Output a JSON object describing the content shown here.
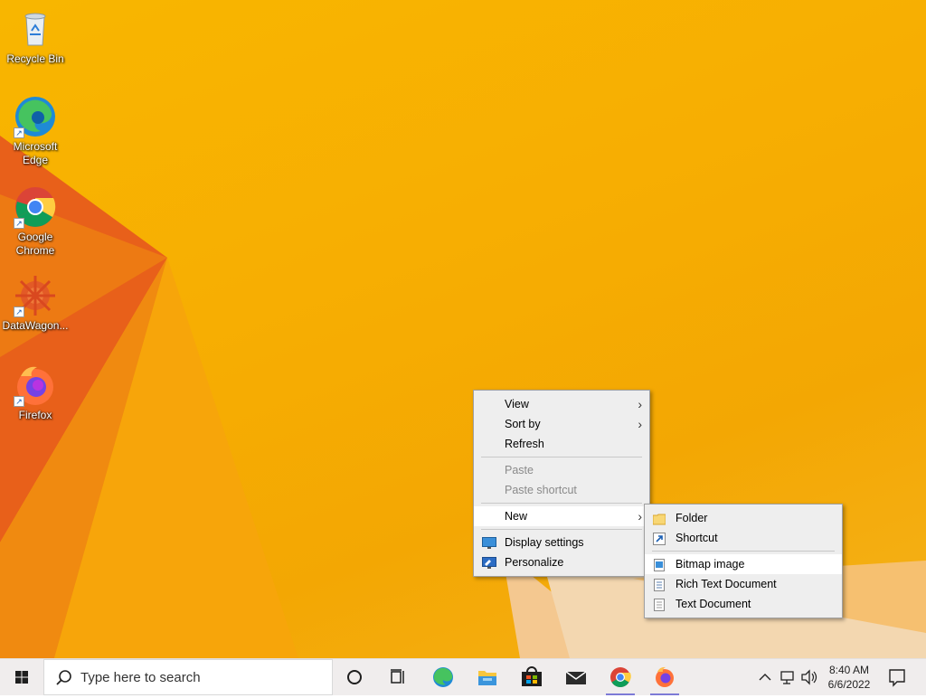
{
  "desktop": {
    "icons": [
      {
        "label": "Recycle Bin",
        "icon": "recycle-bin-icon"
      },
      {
        "label": "Microsoft Edge",
        "icon": "edge-icon"
      },
      {
        "label": "Google Chrome",
        "icon": "chrome-icon"
      },
      {
        "label": "DataWagon...",
        "icon": "datawagon-icon"
      },
      {
        "label": "Firefox",
        "icon": "firefox-icon"
      }
    ]
  },
  "context_menu": {
    "items": [
      {
        "label": "View",
        "has_submenu": true
      },
      {
        "label": "Sort by",
        "has_submenu": true
      },
      {
        "label": "Refresh"
      },
      {
        "label": "Paste",
        "disabled": true
      },
      {
        "label": "Paste shortcut",
        "disabled": true
      },
      {
        "label": "New",
        "has_submenu": true,
        "highlighted": true
      },
      {
        "label": "Display settings",
        "icon": "display-icon"
      },
      {
        "label": "Personalize",
        "icon": "personalize-icon"
      }
    ]
  },
  "new_submenu": {
    "items": [
      {
        "label": "Folder",
        "icon": "folder-icon"
      },
      {
        "label": "Shortcut",
        "icon": "shortcut-icon"
      },
      {
        "label": "Bitmap image",
        "icon": "bitmap-icon",
        "highlighted": true
      },
      {
        "label": "Rich Text Document",
        "icon": "rich-text-icon"
      },
      {
        "label": "Text Document",
        "icon": "text-document-icon"
      }
    ]
  },
  "taskbar": {
    "search_placeholder": "Type here to search",
    "pinned": [
      "cortana-icon",
      "task-view-icon",
      "edge-icon",
      "file-explorer-icon",
      "store-icon",
      "mail-icon",
      "chrome-icon",
      "firefox-icon"
    ],
    "time": "8:40 AM",
    "date": "6/6/2022"
  },
  "colors": {
    "wallpaper": "#f7ae02",
    "menu_bg": "#eeeeee",
    "taskbar_bg": "#f0eded",
    "active_indicator": "#7d7ad6"
  }
}
